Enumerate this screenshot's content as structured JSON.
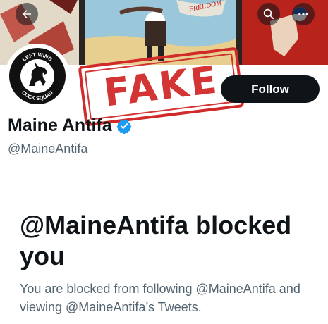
{
  "header": {
    "back_icon": "arrow-left-icon",
    "search_icon": "search-icon",
    "more_icon": "more-icon"
  },
  "profile": {
    "avatar_text_top": "LEFT WING",
    "avatar_text_bottom": "CUCK SQUAD",
    "name": "Maine Antifa",
    "handle": "@MaineAntifa",
    "verified_color": "#1d9bf0",
    "follow_label": "Follow"
  },
  "overlay": {
    "stamp_text": "FAKE",
    "stamp_color": "#d12a2a"
  },
  "blocked": {
    "title": "@MaineAntifa blocked you",
    "description": "You are blocked from following @MaineAntifa and viewing @MaineAntifa’s Tweets."
  },
  "banner_text": "FREEDOM"
}
